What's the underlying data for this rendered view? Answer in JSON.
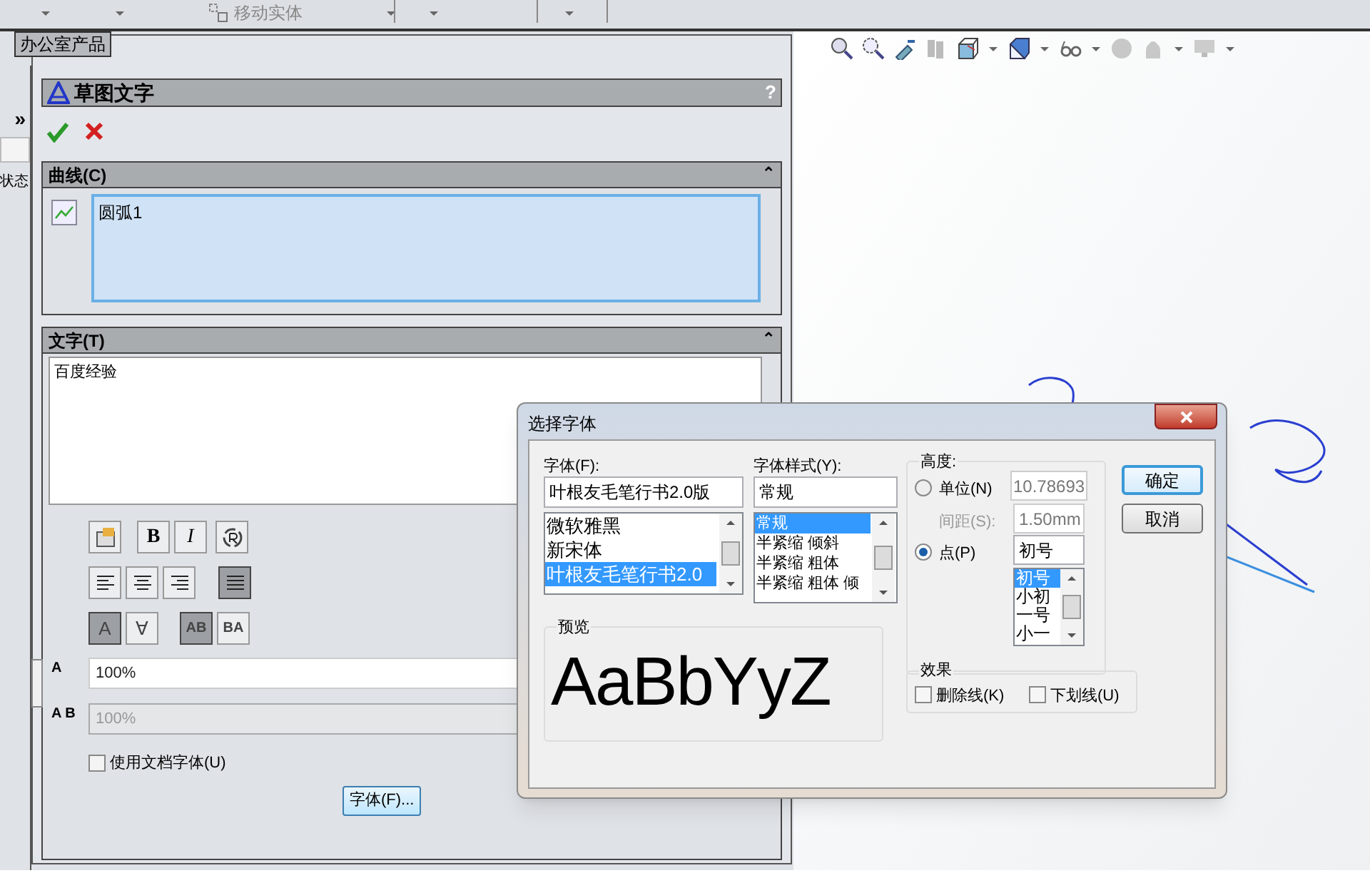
{
  "toolbar": {
    "items": [
      {
        "label": "移动实体"
      }
    ]
  },
  "tab": {
    "label": "办公室产品"
  },
  "left_strip": {
    "expand": "»",
    "label": "状态"
  },
  "property_manager": {
    "title": "草图文字",
    "help": "?",
    "curves": {
      "title": "曲线(C)",
      "collapse": "⌃",
      "items": [
        {
          "label": "圆弧1"
        }
      ]
    },
    "text": {
      "title": "文字(T)",
      "collapse": "⌃",
      "value": "百度经验",
      "style_buttons": [
        {
          "label": "B",
          "pressed": false
        },
        {
          "label": "I",
          "pressed": false
        }
      ],
      "alignment": [
        {
          "selected": false
        },
        {
          "selected": false
        },
        {
          "selected": false
        },
        {
          "selected": true
        }
      ],
      "orientation": [
        {
          "label": "A",
          "selected": true
        },
        {
          "label": "∀",
          "selected": false
        }
      ],
      "direction": [
        {
          "label": "AB",
          "selected": true
        },
        {
          "label": "BA",
          "selected": false
        }
      ],
      "width": {
        "icon_label": "A",
        "value": "100%",
        "disabled": false
      },
      "spacing": {
        "icon_label": "A B",
        "value": "100%",
        "disabled": true
      },
      "use_document_font": {
        "label": "使用文档字体(U)",
        "checked": false
      },
      "font_button": "字体(F)..."
    }
  },
  "font_dialog": {
    "title": "选择字体",
    "font": {
      "label": "字体(F):",
      "value": "叶根友毛笔行书2.0版",
      "items": [
        {
          "label": "微软雅黑",
          "selected": false
        },
        {
          "label": "新宋体",
          "selected": false
        },
        {
          "label": "叶根友毛笔行书2.0",
          "selected": true
        }
      ]
    },
    "style": {
      "label": "字体样式(Y):",
      "value": "常规",
      "items": [
        {
          "label": "常规",
          "selected": true
        },
        {
          "label": "半紧缩 倾斜",
          "selected": false
        },
        {
          "label": "半紧缩 粗体",
          "selected": false
        },
        {
          "label": "半紧缩 粗体 倾",
          "selected": false
        }
      ]
    },
    "height": {
      "label": "高度:",
      "unit": {
        "label": "单位(N)",
        "selected": false,
        "value": "10.78693"
      },
      "spacing": {
        "label": "间距(S):",
        "value": "1.50mm"
      },
      "points": {
        "label": "点(P)",
        "selected": true,
        "value": "初号",
        "items": [
          {
            "label": "初号",
            "selected": true
          },
          {
            "label": "小初",
            "selected": false
          },
          {
            "label": "一号",
            "selected": false
          },
          {
            "label": "小一",
            "selected": false
          }
        ]
      }
    },
    "preview": {
      "label": "预览",
      "sample": "AaBbYyZ"
    },
    "effects": {
      "label": "效果",
      "items": [
        {
          "label": "删除线(K)",
          "checked": false
        },
        {
          "label": "下划线(U)",
          "checked": false
        }
      ]
    },
    "buttons": [
      {
        "label": "确定",
        "default": true
      },
      {
        "label": "取消",
        "default": false
      }
    ]
  }
}
